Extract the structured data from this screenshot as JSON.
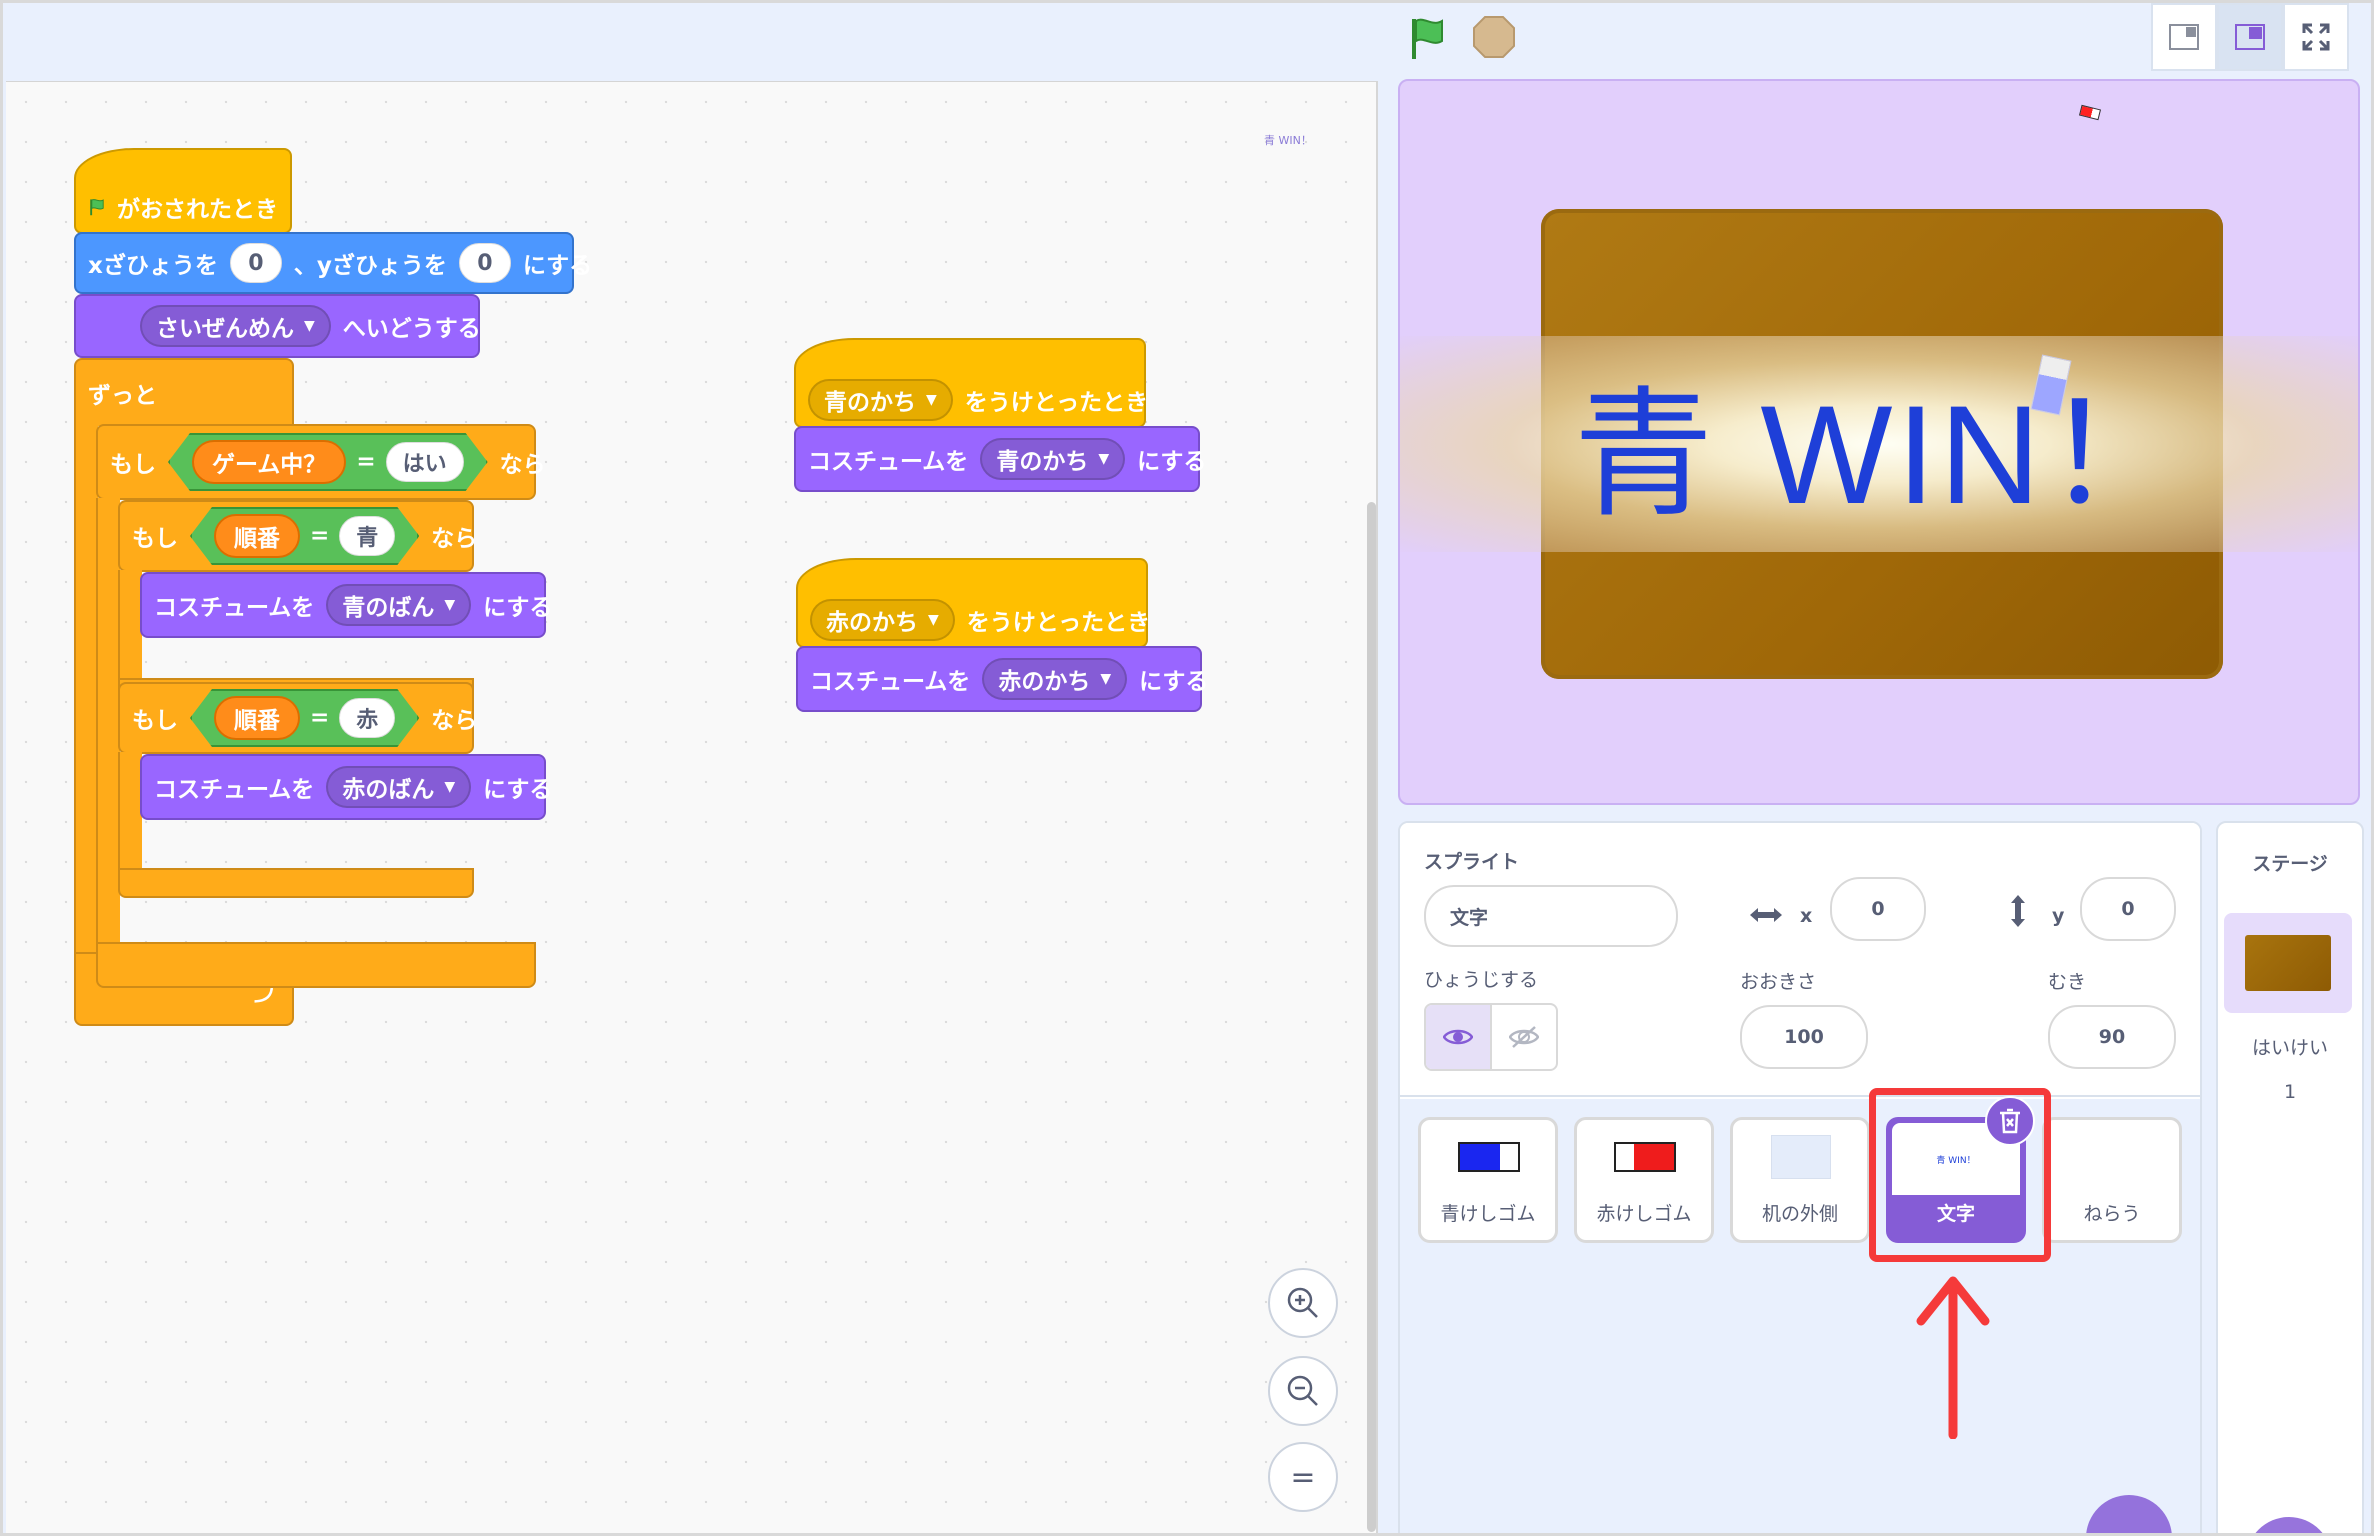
{
  "toolbar": {
    "green_flag_icon": "green-flag-icon",
    "stop_icon": "stop-icon",
    "stage_modes": [
      "small-stage-icon",
      "normal-stage-icon",
      "fullscreen-icon"
    ]
  },
  "workspace": {
    "note": "青 WIN！",
    "script1": {
      "hat": "がおされたとき",
      "goto_pre": "xざひょうを",
      "goto_x": "0",
      "goto_mid": "、yざひょうを",
      "goto_y": "0",
      "goto_post": "にする",
      "layer_value": "さいぜんめん",
      "layer_post": "へいどうする",
      "forever": "ずっと",
      "if1_pre": "もし",
      "if1_var": "ゲーム中？",
      "if1_eq": "=",
      "if1_val": "はい",
      "if1_post": "なら",
      "if2_pre": "もし",
      "if2_var": "順番",
      "if2_eq": "=",
      "if2_val": "青",
      "if2_post": "なら",
      "costume1_pre": "コスチュームを",
      "costume1_val": "青のばん",
      "costume1_post": "にする",
      "if3_pre": "もし",
      "if3_var": "順番",
      "if3_eq": "=",
      "if3_val": "赤",
      "if3_post": "なら",
      "costume2_pre": "コスチュームを",
      "costume2_val": "赤のばん",
      "costume2_post": "にする"
    },
    "script2": {
      "msg": "青のかち",
      "hat_post": "をうけとったとき",
      "costume_pre": "コスチュームを",
      "costume_val": "青のかち",
      "costume_post": "にする"
    },
    "script3": {
      "msg": "赤のかち",
      "hat_post": "をうけとったとき",
      "costume_pre": "コスチュームを",
      "costume_val": "赤のかち",
      "costume_post": "にする"
    },
    "zoom": {
      "in": "+",
      "out": "−",
      "reset": "="
    }
  },
  "stage": {
    "text": "青 WIN！"
  },
  "sprite_info": {
    "sprite_label": "スプライト",
    "sprite_name": "文字",
    "x_label": "x",
    "x_value": "0",
    "y_label": "y",
    "y_value": "0",
    "show_label": "ひょうじする",
    "size_label": "おおきさ",
    "size_value": "100",
    "direction_label": "むき",
    "direction_value": "90"
  },
  "sprites": [
    {
      "name": "青けしゴム"
    },
    {
      "name": "赤けしゴム"
    },
    {
      "name": "机の外側"
    },
    {
      "name": "文字",
      "thumb_text": "青 WIN！"
    },
    {
      "name": "ねらう"
    }
  ],
  "stage_panel": {
    "title": "ステージ",
    "backdrop_label": "はいけい",
    "backdrop_count": "1"
  },
  "colors": {
    "events": "#ffbf00",
    "motion": "#4c97ff",
    "looks": "#9966ff",
    "control": "#ffab19",
    "operators": "#59c059",
    "variables": "#ff8c1a",
    "highlight": "#f53a3a",
    "win_text": "#1e3fd8"
  }
}
